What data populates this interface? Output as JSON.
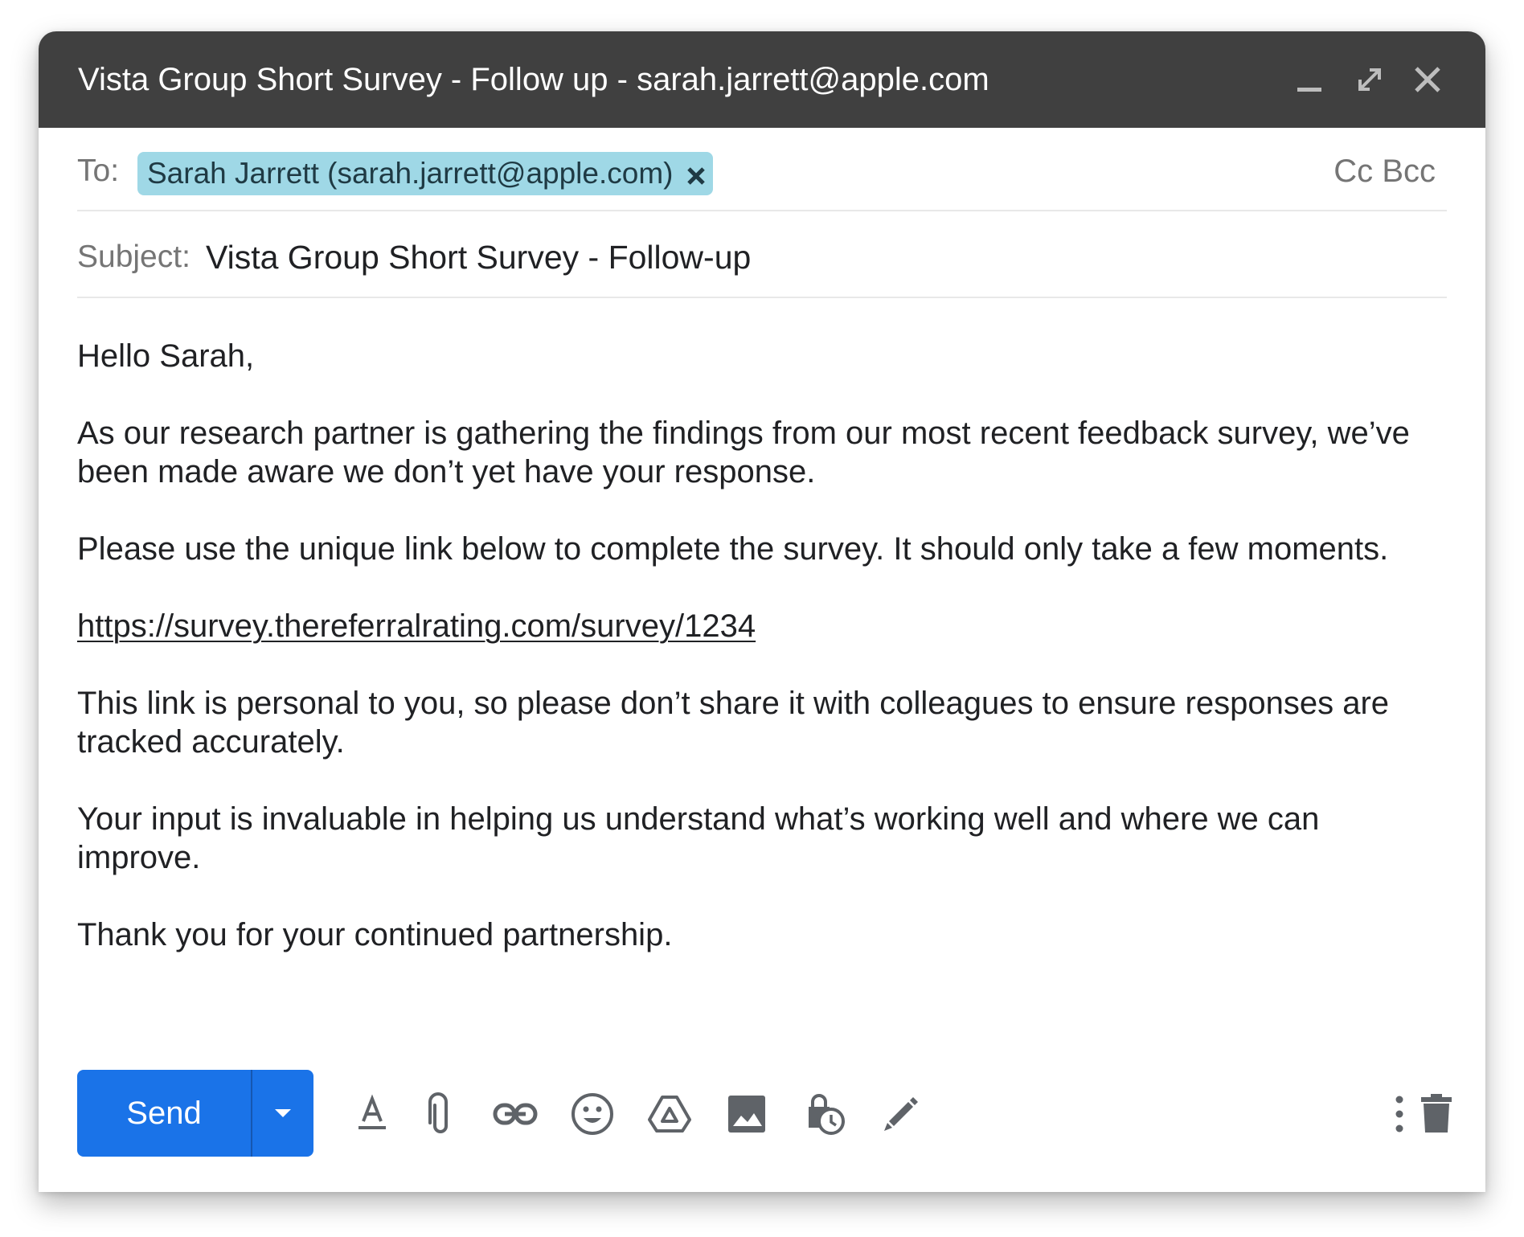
{
  "window": {
    "title": "Vista Group Short Survey - Follow up - sarah.jarrett@apple.com"
  },
  "compose": {
    "to_label": "To:",
    "recipient_chip": "Sarah Jarrett (sarah.jarrett@apple.com)",
    "cc_label": "Cc",
    "bcc_label": "Bcc",
    "subject_label": "Subject:",
    "subject_value": "Vista Group Short Survey - Follow-up"
  },
  "body": {
    "greeting": "Hello Sarah,",
    "paragraph_1": "As our research partner is gathering the findings from our most recent feedback survey, we’ve been made aware we don’t yet have your response.",
    "paragraph_2": "Please use the unique link below to complete the survey. It should only take a few moments.",
    "link": "https://survey.thereferralrating.com/survey/1234",
    "paragraph_3": "This link is personal to you, so please don’t share it with colleagues to ensure responses are tracked accurately.",
    "paragraph_4": "Your input is invaluable in helping us understand what’s working well and where we can improve.",
    "closing": "Thank you for your continued partnership."
  },
  "toolbar": {
    "send_label": "Send",
    "icons": [
      "formatting-options-icon",
      "attach-files-icon",
      "insert-link-icon",
      "insert-emoji-icon",
      "insert-drive-icon",
      "insert-photo-icon",
      "confidential-mode-icon",
      "insert-signature-icon",
      "more-options-icon",
      "discard-draft-icon"
    ]
  },
  "colors": {
    "title_bar": "#404040",
    "send_button": "#1a73e8",
    "recipient_chip": "#9fd8e6",
    "icon_gray": "#5f6368"
  }
}
